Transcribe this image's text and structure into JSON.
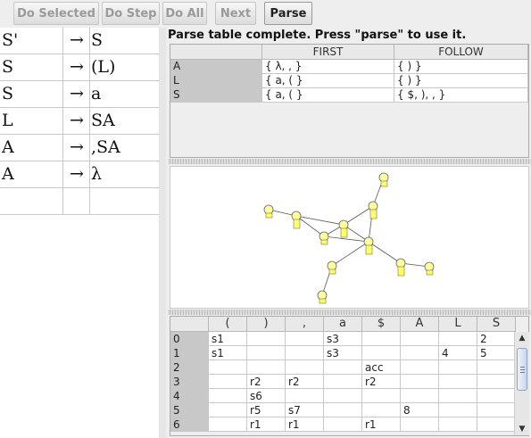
{
  "toolbar": {
    "do_selected": "Do Selected",
    "do_step": "Do Step",
    "do_all": "Do All",
    "next": "Next",
    "parse": "Parse"
  },
  "grammar": {
    "rows": [
      {
        "lhs": "S'",
        "arrow": "→",
        "rhs": "S"
      },
      {
        "lhs": "S",
        "arrow": "→",
        "rhs": "(L)"
      },
      {
        "lhs": "S",
        "arrow": "→",
        "rhs": "a"
      },
      {
        "lhs": "L",
        "arrow": "→",
        "rhs": "SA"
      },
      {
        "lhs": "A",
        "arrow": "→",
        "rhs": ",SA"
      },
      {
        "lhs": "A",
        "arrow": "→",
        "rhs": "λ"
      }
    ]
  },
  "status": "Parse table complete.  Press \"parse\" to use it.",
  "first_follow": {
    "headers": [
      "",
      "FIRST",
      "FOLLOW"
    ],
    "rows": [
      {
        "nt": "A",
        "first": "{ λ, , }",
        "follow": "{ ) }"
      },
      {
        "nt": "L",
        "first": "{ a, ( }",
        "follow": "{ ) }"
      },
      {
        "nt": "S",
        "first": "{ a, ( }",
        "follow": "{ $, ), , }"
      }
    ]
  },
  "parse_table": {
    "headers": [
      "",
      "(",
      ")",
      ",",
      "a",
      "$",
      "A",
      "L",
      "S"
    ],
    "rows": [
      [
        "0",
        "s1",
        "",
        "",
        "s3",
        "",
        "",
        "",
        "2"
      ],
      [
        "1",
        "s1",
        "",
        "",
        "s3",
        "",
        "",
        "4",
        "5"
      ],
      [
        "2",
        "",
        "",
        "",
        "",
        "acc",
        "",
        "",
        ""
      ],
      [
        "3",
        "",
        "r2",
        "r2",
        "",
        "r2",
        "",
        "",
        ""
      ],
      [
        "4",
        "",
        "s6",
        "",
        "",
        "",
        "",
        "",
        ""
      ],
      [
        "5",
        "",
        "r5",
        "s7",
        "",
        "",
        "8",
        "",
        ""
      ],
      [
        "6",
        "",
        "r1",
        "r1",
        "",
        "r1",
        "",
        "",
        ""
      ]
    ]
  },
  "scrollbar": {
    "up_icon": "▲",
    "down_icon": "▼"
  },
  "colors": {
    "node_fill": "#ffff99",
    "row_header": "#c8c8c8",
    "graph_bg": "#ffffff"
  }
}
